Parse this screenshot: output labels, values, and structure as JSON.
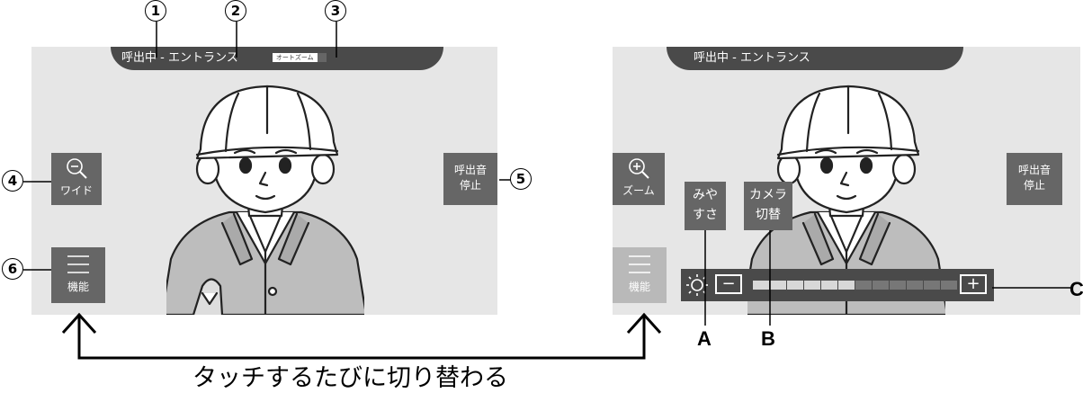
{
  "left_screen": {
    "status_calling": "呼出中",
    "status_separator": "-",
    "status_location": "エントランス",
    "auto_zoom_badge": "オートズーム",
    "wide_button": {
      "icon": "zoom-out-icon",
      "label": "ワイド"
    },
    "stop_ring_button": {
      "line1": "呼出音",
      "line2": "停止"
    },
    "menu_button": {
      "icon": "menu-icon",
      "label": "機能"
    }
  },
  "right_screen": {
    "status_calling": "呼出中",
    "status_separator": "-",
    "status_location": "エントランス",
    "zoom_button": {
      "icon": "zoom-in-icon",
      "label": "ズーム"
    },
    "visibility_button": {
      "line1": "みや",
      "line2": "すさ"
    },
    "camera_switch_button": {
      "line1": "カメラ",
      "line2": "切替"
    },
    "stop_ring_button": {
      "line1": "呼出音",
      "line2": "停止"
    },
    "menu_button": {
      "icon": "menu-icon",
      "label": "機能"
    },
    "brightness": {
      "icon": "sun-icon",
      "minus": "−",
      "plus": "+",
      "level": 6,
      "max": 12
    }
  },
  "callouts": {
    "n1": "1",
    "n2": "2",
    "n3": "3",
    "n4": "4",
    "n5": "5",
    "n6": "6",
    "a": "A",
    "b": "B",
    "c": "C"
  },
  "caption": "タッチするたびに切り替わる",
  "colors": {
    "bar": "#4a4a4a",
    "button": "#666666",
    "screen": "#e6e6e6",
    "seg_on": "#d8d8d8",
    "seg_off": "#777777"
  }
}
